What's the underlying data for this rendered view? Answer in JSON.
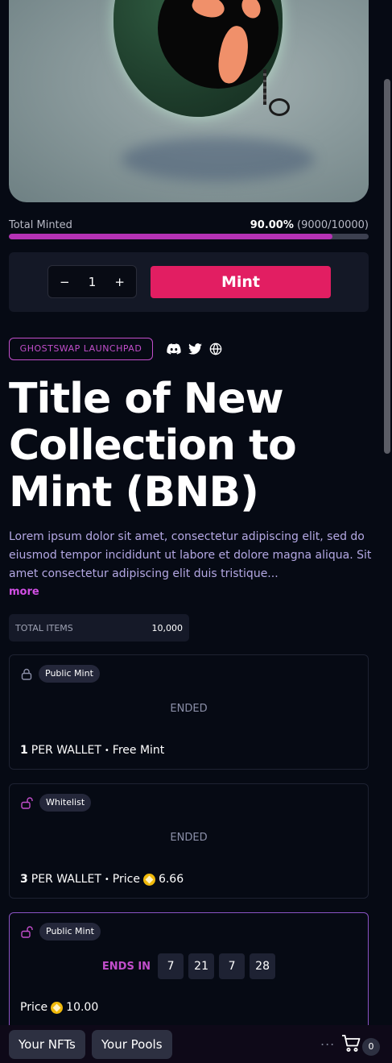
{
  "mint_progress": {
    "label": "Total Minted",
    "percent_text": "90.00%",
    "ratio_text": "(9000/10000)",
    "fraction": 0.9
  },
  "mint_controls": {
    "decrement": "−",
    "quantity": "1",
    "increment": "+",
    "mint_label": "Mint"
  },
  "launchpad": {
    "badge": "GHOSTSWAP LAUNCHPAD",
    "socials": [
      "discord-icon",
      "twitter-icon",
      "globe-icon"
    ]
  },
  "collection": {
    "title": "Title of New Collection to Mint (BNB)",
    "description": "Lorem ipsum dolor sit amet, consectetur adipiscing elit, sed do eiusmod tempor incididunt ut labore et dolore magna aliqua. Sit amet consectetur adipiscing elit duis tristique...",
    "more": "more"
  },
  "stats": {
    "total_items_label": "TOTAL ITEMS",
    "total_items_value": "10,000"
  },
  "phases": [
    {
      "name": "Public Mint",
      "status": "ENDED",
      "per_wallet": "1",
      "per_wallet_label": "PER WALLET",
      "separator": "•",
      "price_text": "Free Mint"
    },
    {
      "name": "Whitelist",
      "status": "ENDED",
      "per_wallet": "3",
      "per_wallet_label": "PER WALLET",
      "separator": "•",
      "price_label": "Price",
      "price_value": "6.66"
    },
    {
      "name": "Public Mint",
      "ends_label": "ENDS IN",
      "countdown": [
        "7",
        "21",
        "7",
        "28"
      ],
      "price_label": "Price",
      "price_value": "10.00"
    }
  ],
  "bottom_bar": {
    "your_nfts": "Your NFTs",
    "your_pools": "Your Pools",
    "more_dots": "...",
    "cart_count": "0"
  },
  "colors": {
    "background": "#060a14",
    "accent_pink": "#e21e62",
    "accent_purple": "#c24ecb",
    "progress_fill": "#b532b5",
    "bnb_coin": "#f0b90b"
  }
}
